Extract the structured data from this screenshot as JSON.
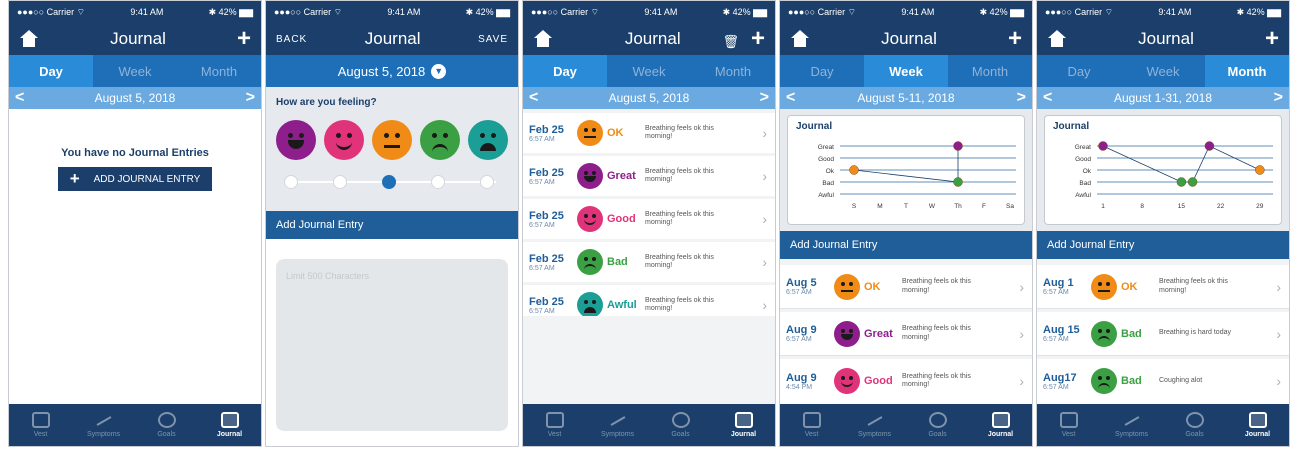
{
  "status": {
    "carrier": "●●●○○ Carrier ⌔",
    "time": "9:41 AM",
    "battery": "✱ 42% ▆▆"
  },
  "colors": {
    "navy": "#1b3f6a",
    "blue": "#1f6fb8",
    "great": "#8e1e8c",
    "good": "#e0337a",
    "ok": "#f08b17",
    "bad": "#3ba043",
    "awful": "#1a9e95"
  },
  "nav": {
    "title": "Journal",
    "back": "BACK",
    "save": "SAVE"
  },
  "segments": [
    "Day",
    "Week",
    "Month"
  ],
  "tabs": [
    "Vest",
    "Symptoms",
    "Goals",
    "Journal"
  ],
  "phone1": {
    "date": "August 5, 2018",
    "empty": "You have no Journal Entries",
    "add_button": "ADD JOURNAL ENTRY"
  },
  "phone2": {
    "date": "August 5, 2018",
    "question": "How are you feeling?",
    "section": "Add Journal Entry",
    "placeholder": "Limit 500 Characters",
    "selected_level": 3
  },
  "phone3": {
    "date": "August 5, 2018",
    "entries": [
      {
        "date": "Feb 25",
        "time": "6:57 AM",
        "mood": "OK",
        "color": "#f08b17",
        "note": "Breathing feels ok this morning!"
      },
      {
        "date": "Feb 25",
        "time": "6:57 AM",
        "mood": "Great",
        "color": "#8e1e8c",
        "note": "Breathing feels ok this morning!"
      },
      {
        "date": "Feb 25",
        "time": "6:57 AM",
        "mood": "Good",
        "color": "#e0337a",
        "note": "Breathing feels ok this morning!"
      },
      {
        "date": "Feb 25",
        "time": "6:57 AM",
        "mood": "Bad",
        "color": "#3ba043",
        "note": "Breathing feels ok this morning!"
      },
      {
        "date": "Feb 25",
        "time": "6:57 AM",
        "mood": "Awful",
        "color": "#1a9e95",
        "note": "Breathing feels ok this morning!"
      }
    ]
  },
  "phone4": {
    "date": "August 5-11, 2018",
    "section": "Add Journal Entry",
    "entries": [
      {
        "date": "Aug 5",
        "time": "6:57 AM",
        "mood": "OK",
        "color": "#f08b17",
        "note": "Breathing feels ok this morning!"
      },
      {
        "date": "Aug 9",
        "time": "6:57 AM",
        "mood": "Great",
        "color": "#8e1e8c",
        "note": "Breathing feels ok this morning!"
      },
      {
        "date": "Aug 9",
        "time": "4:54 PM",
        "mood": "Good",
        "color": "#e0337a",
        "note": "Breathing feels ok this morning!"
      }
    ]
  },
  "phone5": {
    "date": "August 1-31, 2018",
    "section": "Add Journal Entry",
    "entries": [
      {
        "date": "Aug 1",
        "time": "6:57 AM",
        "mood": "OK",
        "color": "#f08b17",
        "note": "Breathing feels ok this morning!"
      },
      {
        "date": "Aug 15",
        "time": "6:57 AM",
        "mood": "Bad",
        "color": "#3ba043",
        "note": "Breathing is hard today"
      },
      {
        "date": "Aug17",
        "time": "6:57 AM",
        "mood": "Bad",
        "color": "#3ba043",
        "note": "Coughing alot"
      }
    ]
  },
  "chart_data": [
    {
      "type": "line",
      "title": "Journal",
      "categories": [
        "S",
        "M",
        "T",
        "W",
        "Th",
        "F",
        "Sa"
      ],
      "ylabels": [
        "Great",
        "Good",
        "Ok",
        "Bad",
        "Awful"
      ],
      "points": [
        {
          "x": "S",
          "y": "Ok"
        },
        {
          "x": "Th",
          "y": "Bad"
        },
        {
          "x": "Th",
          "y": "Great"
        }
      ]
    },
    {
      "type": "line",
      "title": "Journal",
      "ticks": [
        "1",
        "8",
        "15",
        "22",
        "29"
      ],
      "xlim": [
        1,
        31
      ],
      "ylabels": [
        "Great",
        "Good",
        "Ok",
        "Bad",
        "Awful"
      ],
      "points": [
        {
          "x": 1,
          "y": "Great"
        },
        {
          "x": 15,
          "y": "Bad"
        },
        {
          "x": 17,
          "y": "Bad"
        },
        {
          "x": 20,
          "y": "Great"
        },
        {
          "x": 29,
          "y": "Ok"
        }
      ]
    }
  ]
}
